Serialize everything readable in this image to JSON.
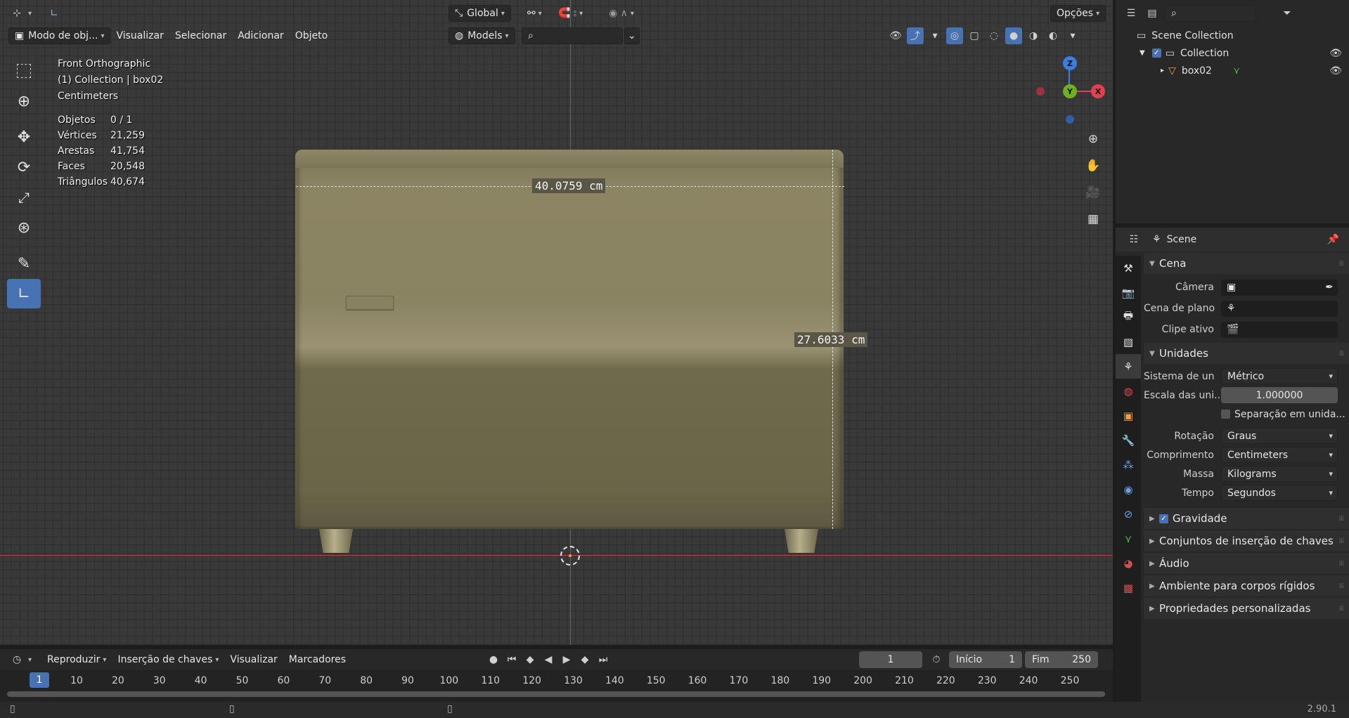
{
  "viewport_header": {
    "mode_label": "Modo de obj...",
    "menus": [
      "Visualizar",
      "Selecionar",
      "Adicionar",
      "Objeto"
    ],
    "transform_orientation": "Global",
    "collection_filter": "Models",
    "options_label": "Opções"
  },
  "overlay": {
    "view_name": "Front Orthographic",
    "collection_line": "(1) Collection | box02",
    "units_line": "Centimeters"
  },
  "stats": [
    {
      "label": "Objetos",
      "value": "0 / 1"
    },
    {
      "label": "Vértices",
      "value": "21,259"
    },
    {
      "label": "Arestas",
      "value": "41,754"
    },
    {
      "label": "Faces",
      "value": "20,548"
    },
    {
      "label": "Triângulos",
      "value": "40,674"
    }
  ],
  "measurements": {
    "width": "40.0759 cm",
    "height": "27.6033 cm"
  },
  "gizmo": {
    "z": "Z",
    "y": "Y",
    "x": "X"
  },
  "timeline": {
    "menus": [
      "Reproduzir",
      "Inserção de chaves",
      "Visualizar",
      "Marcadores"
    ],
    "current_frame": "1",
    "start_label": "Início",
    "start_value": "1",
    "end_label": "Fim",
    "end_value": "250",
    "ticks": [
      "1",
      "10",
      "20",
      "30",
      "40",
      "50",
      "60",
      "70",
      "80",
      "90",
      "100",
      "110",
      "120",
      "130",
      "140",
      "150",
      "160",
      "170",
      "180",
      "190",
      "200",
      "210",
      "220",
      "230",
      "240",
      "250"
    ]
  },
  "outliner": {
    "scene_collection": "Scene Collection",
    "collection": "Collection",
    "object": "box02"
  },
  "properties": {
    "header_title": "Scene",
    "cena": {
      "title": "Cena",
      "camera_label": "Câmera",
      "background_label": "Cena de plano",
      "clip_label": "Clipe ativo"
    },
    "unidades": {
      "title": "Unidades",
      "system_label": "Sistema de un",
      "system_value": "Métrico",
      "scale_label": "Escala das uni...",
      "scale_value": "1.000000",
      "separate_label": "Separação em unida...",
      "rotation_label": "Rotação",
      "rotation_value": "Graus",
      "length_label": "Comprimento",
      "length_value": "Centimeters",
      "mass_label": "Massa",
      "mass_value": "Kilograms",
      "time_label": "Tempo",
      "time_value": "Segundos"
    },
    "collapsed_panels": [
      "Gravidade",
      "Conjuntos de inserção de chaves",
      "Áudio",
      "Ambiente para corpos rígidos",
      "Propriedades personalizadas"
    ]
  },
  "status": {
    "version": "2.90.1"
  }
}
